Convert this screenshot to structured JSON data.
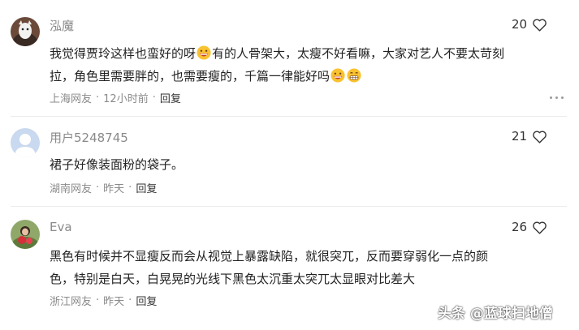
{
  "comments": [
    {
      "username": "泓魔",
      "likes": "20",
      "text_line1": "我觉得贾玲这样也蛮好的呀",
      "text_line1_after_emoji": "有的人骨架大，太瘦不好看嘛，大家对艺人不要太苛刻",
      "text_line2": "拉，角色里需要胖的，也需要瘦的，千篇一律能好吗",
      "location": "上海网友",
      "time": "12小时前",
      "reply": "回复",
      "emoji_names": [
        "grin-emoji",
        "grin-emoji",
        "grimace-emoji"
      ]
    },
    {
      "username": "用户5248745",
      "likes": "21",
      "text_line1": "裙子好像装面粉的袋子。",
      "location": "湖南网友",
      "time": "昨天",
      "reply": "回复"
    },
    {
      "username": "Eva",
      "likes": "26",
      "text_line1": "黑色有时候并不显瘦反而会从视觉上暴露缺陷，就很突兀，反而要穿弱化一点的颜",
      "text_line2": "色，特别是白天，白晃晃的光线下黑色太沉重太突兀太显眼对比差大",
      "location": "浙江网友",
      "time": "昨天",
      "reply": "回复"
    }
  ],
  "meta_separator": "·",
  "watermark": "头条 @蓝球扫地僧",
  "colors": {
    "secondary_text": "#8a8a8a",
    "primary_text": "#222222",
    "divider": "#ececec"
  }
}
